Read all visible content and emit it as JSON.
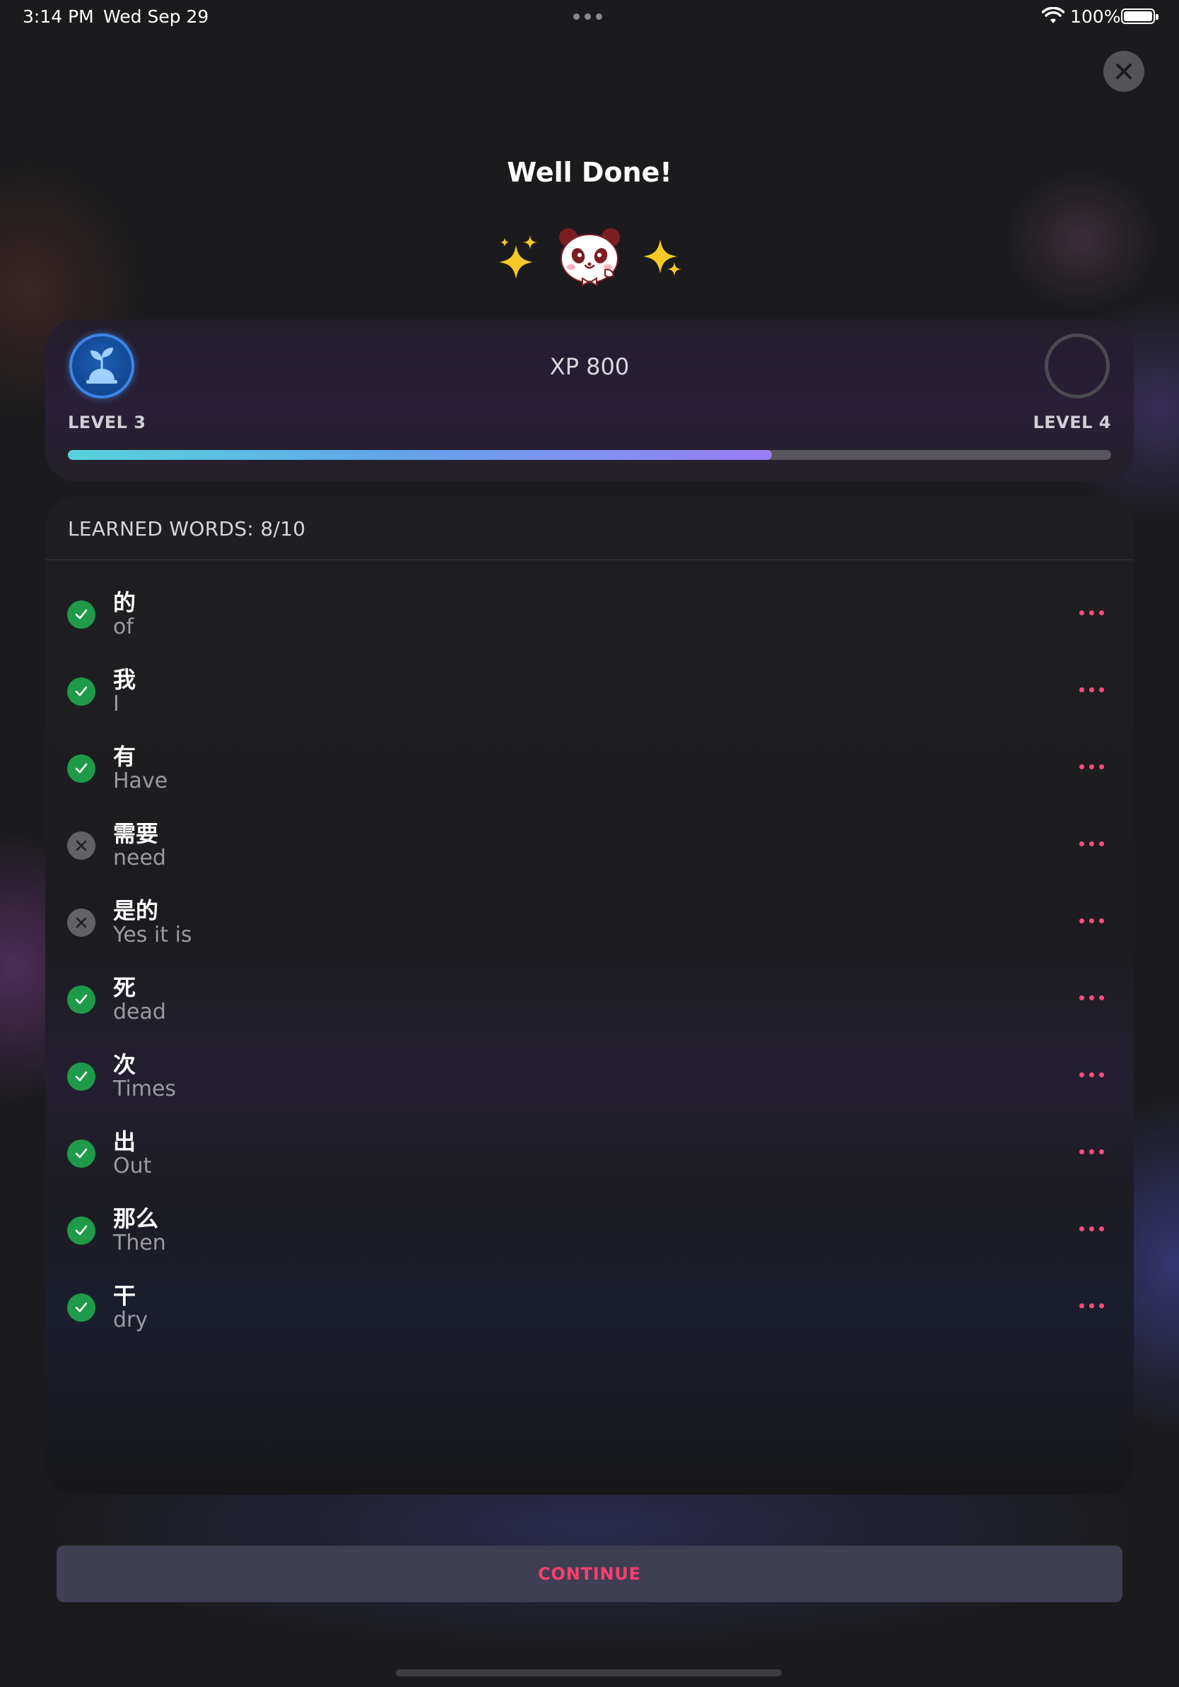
{
  "status_bar": {
    "time": "3:14 PM",
    "date": "Wed Sep 29",
    "battery_pct": "100%"
  },
  "title": "Well Done!",
  "mascot": {
    "left": "sparkles-icon",
    "center": "panda-mascot-icon",
    "right": "sparkles-icon"
  },
  "xp": {
    "label": "XP 800",
    "current_level": "LEVEL 3",
    "next_level": "LEVEL 4",
    "progress": 0.675,
    "current_level_icon": "sprout-icon"
  },
  "words": {
    "header": "LEARNED WORDS: 8/10",
    "items": [
      {
        "zh": "的",
        "en": "of",
        "learned": true
      },
      {
        "zh": "我",
        "en": "I",
        "learned": true
      },
      {
        "zh": "有",
        "en": "Have",
        "learned": true
      },
      {
        "zh": "需要",
        "en": "need",
        "learned": false
      },
      {
        "zh": "是的",
        "en": "Yes it is",
        "learned": false
      },
      {
        "zh": "死",
        "en": "dead",
        "learned": true
      },
      {
        "zh": "次",
        "en": "Times",
        "learned": true
      },
      {
        "zh": "出",
        "en": "Out",
        "learned": true
      },
      {
        "zh": "那么",
        "en": "Then",
        "learned": true
      },
      {
        "zh": "干",
        "en": "dry",
        "learned": true
      }
    ]
  },
  "continue_label": "CONTINUE",
  "colors": {
    "accent": "#ff4d7a",
    "learned": "#1f9a4a",
    "not_learned": "#626266"
  }
}
